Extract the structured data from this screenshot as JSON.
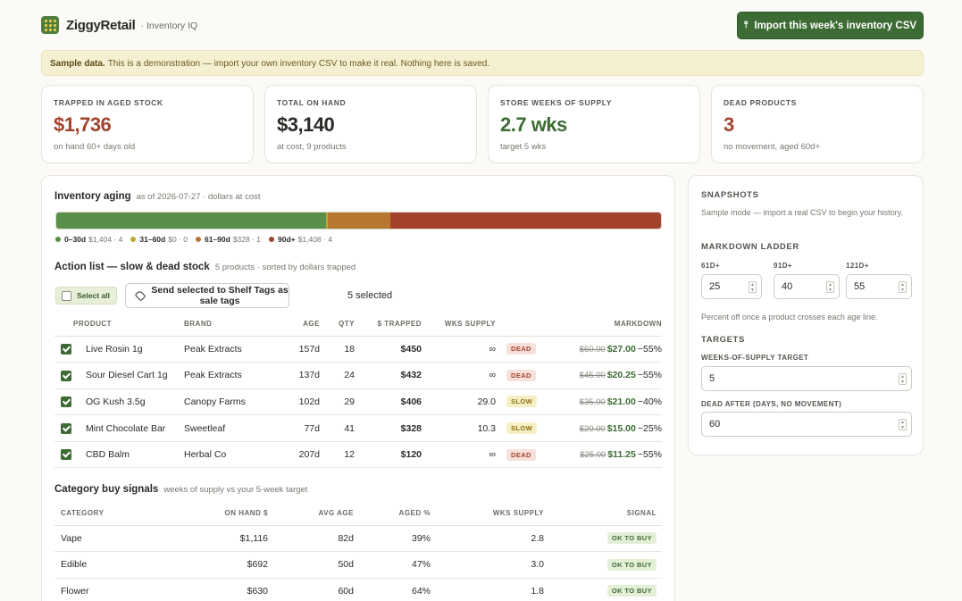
{
  "header": {
    "brand_name": "ZiggyRetail",
    "brand_sub": "· Inventory IQ",
    "import_button": "Import this week's inventory CSV",
    "import_icon": "upload-icon"
  },
  "banner": {
    "label": "Sample data.",
    "text": "This is a demonstration — import your own inventory CSV to make it real. Nothing here is saved."
  },
  "kpis": [
    {
      "label": "TRAPPED IN AGED STOCK",
      "value": "$1,736",
      "sub": "on hand 60+ days old",
      "color": "#a3432e"
    },
    {
      "label": "TOTAL ON HAND",
      "value": "$3,140",
      "sub": "at cost, 9 products",
      "color": "#2a2a26"
    },
    {
      "label": "STORE WEEKS OF SUPPLY",
      "value": "2.7 wks",
      "sub": "target 5 wks",
      "color": "#3d6b34"
    },
    {
      "label": "DEAD PRODUCTS",
      "value": "3",
      "sub": "no movement, aged 60d+",
      "color": "#a3432e"
    }
  ],
  "aging": {
    "title": "Inventory aging",
    "subtitle": "as of 2026-07-27 · dollars at cost",
    "segments": [
      {
        "label": "0–30d",
        "meta": "$1,404 · 4",
        "value": 1404,
        "color": "#5a8f4a"
      },
      {
        "label": "31–60d",
        "meta": "$0 · 0",
        "value": 8,
        "color": "#c0a932"
      },
      {
        "label": "61–90d",
        "meta": "$328 · 1",
        "value": 328,
        "color": "#b8772e"
      },
      {
        "label": "90d+",
        "meta": "$1,408 · 4",
        "value": 1408,
        "color": "#a3432e"
      }
    ]
  },
  "actions": {
    "title": "Action list — slow & dead stock",
    "subtitle": "5 products · sorted by dollars trapped",
    "select_all": "Select all",
    "send_button": "Send selected to Shelf Tags as sale tags",
    "send_icon": "tag-icon",
    "selected_count": "5 selected",
    "columns": [
      "PRODUCT",
      "BRAND",
      "AGE",
      "QTY",
      "$ TRAPPED",
      "WKS SUPPLY",
      "",
      "MARKDOWN"
    ],
    "rows": [
      {
        "product": "Live Rosin 1g",
        "brand": "Peak Extracts",
        "age": "157d",
        "qty": "18",
        "trapped": "$450",
        "wks": "∞",
        "status": "DEAD",
        "status_type": "dead",
        "old": "$60.00",
        "new": "$27.00",
        "pct": "−55%"
      },
      {
        "product": "Sour Diesel Cart 1g",
        "brand": "Peak Extracts",
        "age": "137d",
        "qty": "24",
        "trapped": "$432",
        "wks": "∞",
        "status": "DEAD",
        "status_type": "dead",
        "old": "$45.00",
        "new": "$20.25",
        "pct": "−55%"
      },
      {
        "product": "OG Kush 3.5g",
        "brand": "Canopy Farms",
        "age": "102d",
        "qty": "29",
        "trapped": "$406",
        "wks": "29.0",
        "status": "SLOW",
        "status_type": "slow",
        "old": "$35.00",
        "new": "$21.00",
        "pct": "−40%"
      },
      {
        "product": "Mint Chocolate Bar",
        "brand": "Sweetleaf",
        "age": "77d",
        "qty": "41",
        "trapped": "$328",
        "wks": "10.3",
        "status": "SLOW",
        "status_type": "slow",
        "old": "$20.00",
        "new": "$15.00",
        "pct": "−25%"
      },
      {
        "product": "CBD Balm",
        "brand": "Herbal Co",
        "age": "207d",
        "qty": "12",
        "trapped": "$120",
        "wks": "∞",
        "status": "DEAD",
        "status_type": "dead",
        "old": "$25.00",
        "new": "$11.25",
        "pct": "−55%"
      }
    ]
  },
  "categories": {
    "title": "Category buy signals",
    "subtitle": "weeks of supply vs your 5-week target",
    "columns": [
      "CATEGORY",
      "ON HAND $",
      "AVG AGE",
      "AGED %",
      "WKS SUPPLY",
      "SIGNAL"
    ],
    "rows": [
      {
        "category": "Vape",
        "on_hand": "$1,116",
        "avg_age": "82d",
        "aged": "39%",
        "wks": "2.8",
        "signal": "OK TO BUY"
      },
      {
        "category": "Edible",
        "on_hand": "$692",
        "avg_age": "50d",
        "aged": "47%",
        "wks": "3.0",
        "signal": "OK TO BUY"
      },
      {
        "category": "Flower",
        "on_hand": "$630",
        "avg_age": "60d",
        "aged": "64%",
        "wks": "1.8",
        "signal": "OK TO BUY"
      }
    ]
  },
  "side": {
    "snapshots_title": "SNAPSHOTS",
    "snapshots_text": "Sample mode — import a real CSV to begin your history.",
    "ladder_title": "MARKDOWN LADDER",
    "ladder": [
      {
        "label": "61D+",
        "value": "25"
      },
      {
        "label": "91D+",
        "value": "40"
      },
      {
        "label": "121D+",
        "value": "55"
      }
    ],
    "ladder_note": "Percent off once a product crosses each age line.",
    "targets_title": "TARGETS",
    "wos_label": "WEEKS-OF-SUPPLY TARGET",
    "wos_value": "5",
    "dead_label": "DEAD AFTER (DAYS, NO MOVEMENT)",
    "dead_value": "60"
  }
}
